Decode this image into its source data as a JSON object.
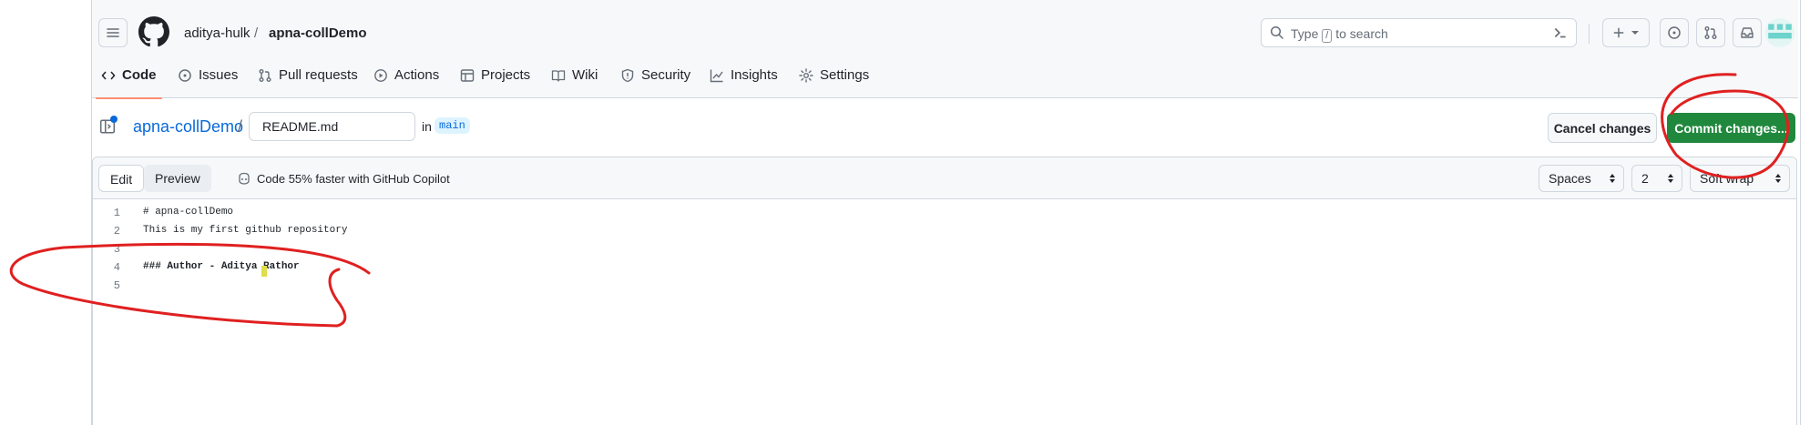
{
  "header": {
    "owner": "aditya-hulk",
    "separator": "/",
    "repo": "apna-collDemo",
    "search": {
      "prefix": "Type",
      "key": "/",
      "suffix": "to search"
    }
  },
  "tabs": [
    {
      "label": "Code",
      "icon": "code-icon"
    },
    {
      "label": "Issues",
      "icon": "issue-icon"
    },
    {
      "label": "Pull requests",
      "icon": "pull-request-icon"
    },
    {
      "label": "Actions",
      "icon": "play-icon"
    },
    {
      "label": "Projects",
      "icon": "table-icon"
    },
    {
      "label": "Wiki",
      "icon": "book-icon"
    },
    {
      "label": "Security",
      "icon": "shield-icon"
    },
    {
      "label": "Insights",
      "icon": "graph-icon"
    },
    {
      "label": "Settings",
      "icon": "gear-icon"
    }
  ],
  "editor_header": {
    "repo_link": "apna-collDemo",
    "slash": "/",
    "filename": "README.md",
    "in_label": "in",
    "branch": "main",
    "cancel_label": "Cancel changes",
    "commit_label": "Commit changes..."
  },
  "editor": {
    "edit_tab": "Edit",
    "preview_tab": "Preview",
    "copilot_text": "Code 55% faster with GitHub Copilot",
    "indent_mode": "Spaces",
    "indent_size": "2",
    "wrap_mode": "Soft wrap",
    "lines": [
      {
        "num": "1",
        "text": "# apna-collDemo"
      },
      {
        "num": "2",
        "text": "This is my first github repository"
      },
      {
        "num": "3",
        "text": ""
      },
      {
        "num": "4",
        "text": "### Author - Aditya Rathor"
      },
      {
        "num": "5",
        "text": ""
      }
    ]
  },
  "colors": {
    "commit_green": "#1f883d",
    "link_blue": "#0969da",
    "annotation_red": "#e02020",
    "active_tab_underline": "#fd8c73"
  }
}
